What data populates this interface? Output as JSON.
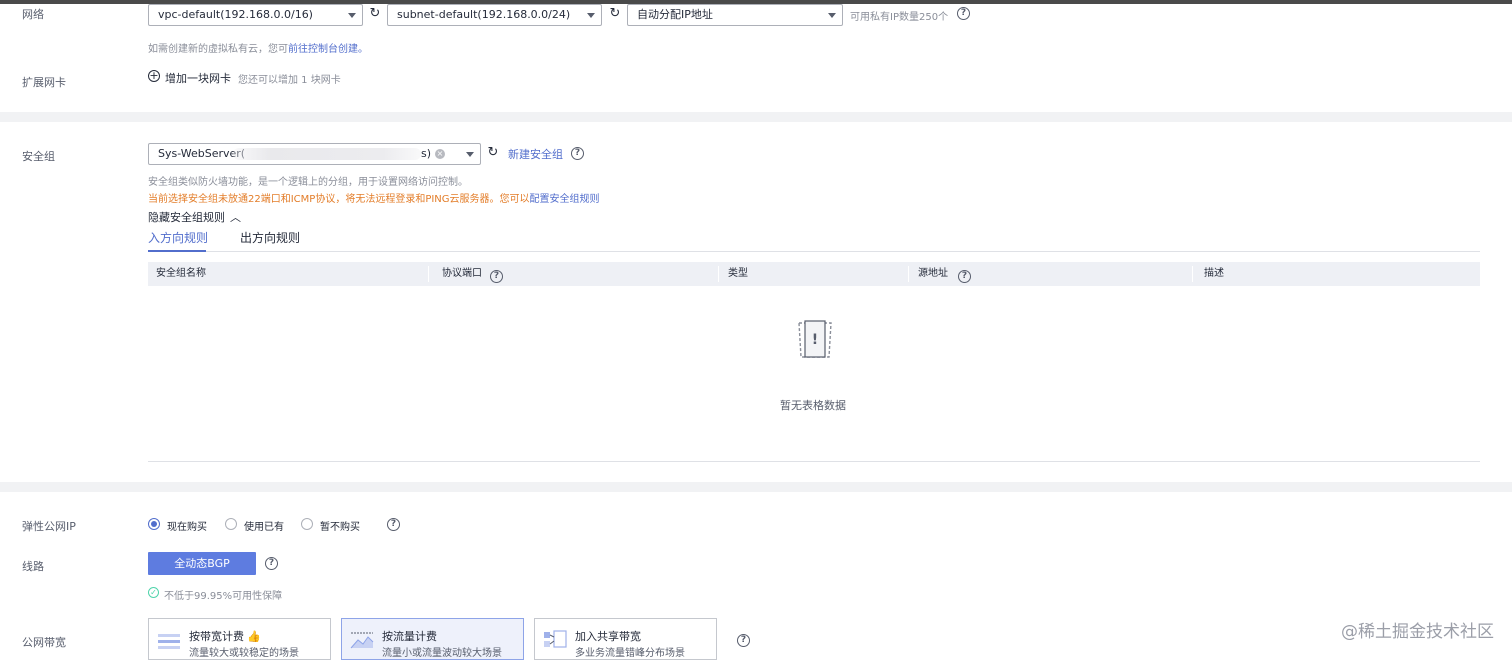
{
  "network": {
    "label": "网络",
    "vpc_value": "vpc-default(192.168.0.0/16)",
    "subnet_value": "subnet-default(192.168.0.0/24)",
    "ip_value": "自动分配IP地址",
    "ip_available": "可用私有IP数量250个",
    "hint_prefix": "如需创建新的虚拟私有云，您可",
    "hint_link": "前往控制台创建。",
    "ext_nic_label": "扩展网卡",
    "add_nic": "增加一块网卡",
    "add_nic_hint": "您还可以增加 1 块网卡"
  },
  "security": {
    "label": "安全组",
    "select_prefix": "Sys-WebServer(",
    "select_suffix": "s)",
    "new_group": "新建安全组",
    "desc": "安全组类似防火墙功能，是一个逻辑上的分组，用于设置网络访问控制。",
    "warning": "当前选择安全组未放通22端口和ICMP协议，将无法远程登录和PING云服务器。您可以",
    "warning_link": "配置安全组规则",
    "toggle_rules": "隐藏安全组规则",
    "tabs": [
      {
        "label": "入方向规则",
        "active": true
      },
      {
        "label": "出方向规则",
        "active": false
      }
    ],
    "columns": [
      "安全组名称",
      "协议端口",
      "类型",
      "源地址",
      "描述"
    ],
    "empty_text": "暂无表格数据"
  },
  "eip": {
    "label": "弹性公网IP",
    "options": [
      {
        "label": "现在购买",
        "selected": true
      },
      {
        "label": "使用已有",
        "selected": false
      },
      {
        "label": "暂不购买",
        "selected": false
      }
    ],
    "line_label": "线路",
    "line_button": "全动态BGP",
    "sla": "不低于99.95%可用性保障",
    "bandwidth_label": "公网带宽",
    "bandwidth_cards": [
      {
        "title": "按带宽计费",
        "desc": "流量较大或较稳定的场景",
        "selected": false
      },
      {
        "title": "按流量计费",
        "desc": "流量小或流量波动较大场景",
        "selected": true
      },
      {
        "title": "加入共享带宽",
        "desc": "多业务流量错峰分布场景",
        "selected": false
      }
    ]
  },
  "watermark": "@稀土掘金技术社区",
  "colors": {
    "accent": "#526ecc",
    "warning": "#e37d29",
    "success": "#50d4ab"
  }
}
